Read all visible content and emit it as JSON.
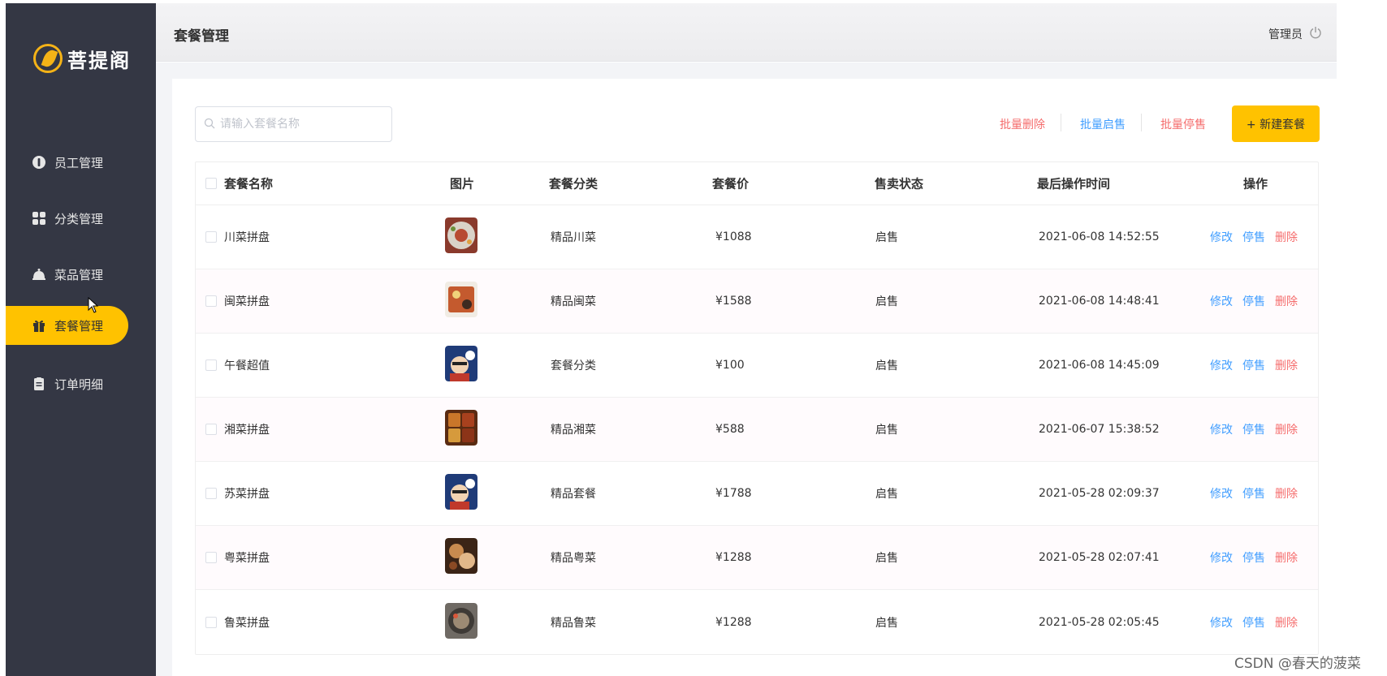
{
  "app": {
    "logo_text": "菩提阁"
  },
  "sidebar": {
    "items": [
      {
        "label": "员工管理",
        "icon": "employee-icon",
        "active": false
      },
      {
        "label": "分类管理",
        "icon": "category-grid-icon",
        "active": false
      },
      {
        "label": "菜品管理",
        "icon": "dish-cloche-icon",
        "active": false
      },
      {
        "label": "套餐管理",
        "icon": "gift-icon",
        "active": true
      },
      {
        "label": "订单明细",
        "icon": "clipboard-icon",
        "active": false
      }
    ]
  },
  "header": {
    "title": "套餐管理",
    "user": "管理员",
    "logout_icon": "power-icon"
  },
  "toolbar": {
    "search_placeholder": "请输入套餐名称",
    "batch_delete": "批量删除",
    "batch_enable": "批量启售",
    "batch_disable": "批量停售",
    "new_button": "+ 新建套餐"
  },
  "table": {
    "headers": {
      "name": "套餐名称",
      "image": "图片",
      "category": "套餐分类",
      "price": "套餐价",
      "status": "售卖状态",
      "updated": "最后操作时间",
      "actions": "操作"
    },
    "actions": {
      "edit": "修改",
      "disable": "停售",
      "delete": "删除"
    },
    "rows": [
      {
        "name": "川菜拼盘",
        "category": "精品川菜",
        "price": "¥1088",
        "status": "启售",
        "updated": "2021-06-08 14:52:55"
      },
      {
        "name": "闽菜拼盘",
        "category": "精品闽菜",
        "price": "¥1588",
        "status": "启售",
        "updated": "2021-06-08 14:48:41"
      },
      {
        "name": "午餐超值",
        "category": "套餐分类",
        "price": "¥100",
        "status": "启售",
        "updated": "2021-06-08 14:45:09"
      },
      {
        "name": "湘菜拼盘",
        "category": "精品湘菜",
        "price": "¥588",
        "status": "启售",
        "updated": "2021-06-07 15:38:52"
      },
      {
        "name": "苏菜拼盘",
        "category": "精品套餐",
        "price": "¥1788",
        "status": "启售",
        "updated": "2021-05-28 02:09:37"
      },
      {
        "name": "粤菜拼盘",
        "category": "精品粤菜",
        "price": "¥1288",
        "status": "启售",
        "updated": "2021-05-28 02:07:41"
      },
      {
        "name": "鲁菜拼盘",
        "category": "精品鲁菜",
        "price": "¥1288",
        "status": "启售",
        "updated": "2021-05-28 02:05:45"
      }
    ]
  },
  "watermark": "CSDN @春天的菠菜",
  "colors": {
    "sidebar": "#343744",
    "accent": "#ffc200",
    "link_blue": "#419eff",
    "link_red": "#f56c6c"
  }
}
